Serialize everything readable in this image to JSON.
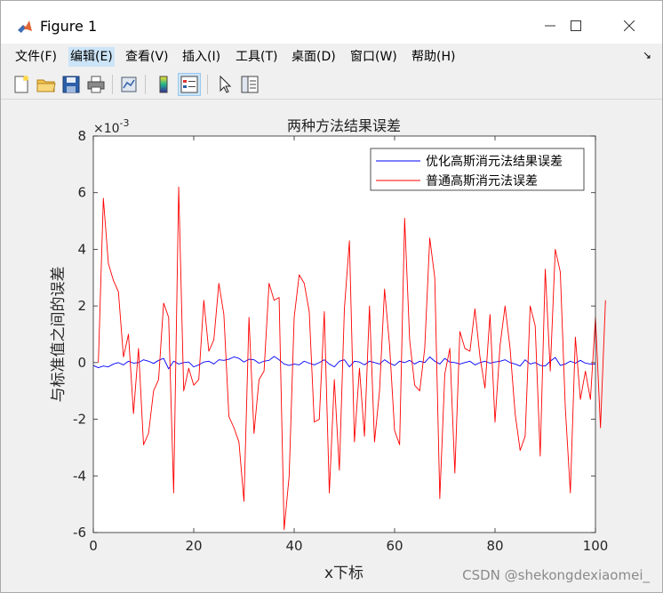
{
  "window": {
    "title": "Figure 1",
    "minimize_icon": "minimize-icon",
    "maximize_icon": "maximize-icon",
    "close_icon": "close-icon"
  },
  "menu": {
    "items": [
      {
        "label": "文件(F)"
      },
      {
        "label": "编辑(E)"
      },
      {
        "label": "查看(V)"
      },
      {
        "label": "插入(I)"
      },
      {
        "label": "工具(T)"
      },
      {
        "label": "桌面(D)"
      },
      {
        "label": "窗口(W)"
      },
      {
        "label": "帮助(H)"
      }
    ],
    "active_index": 1,
    "corner_glyph": "↘"
  },
  "toolbar": {
    "buttons": [
      {
        "icon": "new-figure-icon"
      },
      {
        "icon": "open-folder-icon"
      },
      {
        "icon": "save-icon"
      },
      {
        "icon": "print-icon"
      },
      {
        "icon": "link-plot-icon"
      },
      {
        "icon": "colorbar-icon"
      },
      {
        "icon": "legend-icon"
      },
      {
        "icon": "pointer-icon"
      },
      {
        "icon": "property-editor-icon"
      }
    ],
    "active_icon": "legend-icon"
  },
  "chart_data": {
    "type": "line",
    "title": "两种方法结果误差",
    "xlabel": "x下标",
    "ylabel": "与标准值之间的误差",
    "exponent_label": "×10",
    "exponent_power": "-3",
    "xlim": [
      0,
      100
    ],
    "ylim": [
      -6,
      8
    ],
    "xticks": [
      0,
      20,
      40,
      60,
      80,
      100
    ],
    "yticks": [
      -6,
      -4,
      -2,
      0,
      2,
      4,
      6,
      8
    ],
    "grid": false,
    "legend_position": "top-right",
    "series": [
      {
        "name": "优化高斯消元法结果误差",
        "color": "#0000ff",
        "values": [
          -0.1,
          -0.18,
          -0.12,
          -0.15,
          -0.05,
          0.0,
          -0.08,
          0.05,
          -0.02,
          0.0,
          0.1,
          0.05,
          -0.03,
          0.08,
          0.15,
          -0.22,
          0.05,
          -0.05,
          0.0,
          0.02,
          -0.15,
          -0.08,
          0.02,
          0.05,
          -0.05,
          0.1,
          0.08,
          0.12,
          0.2,
          0.15,
          0.02,
          0.12,
          0.1,
          -0.02,
          0.05,
          0.08,
          0.22,
          0.1,
          -0.05,
          -0.1,
          -0.05,
          -0.08,
          0.05,
          -0.02,
          -0.08,
          0.0,
          0.1,
          -0.05,
          -0.15,
          0.05,
          0.1,
          -0.15,
          0.05,
          0.02,
          -0.08,
          0.05,
          0.0,
          -0.05,
          0.1,
          -0.02,
          -0.1,
          0.05,
          0.0,
          0.08,
          -0.05,
          0.05,
          0.0,
          0.2,
          0.05,
          -0.05,
          0.15,
          0.02,
          0.0,
          -0.05,
          0.0,
          0.05,
          -0.08,
          0.0,
          0.05,
          -0.02,
          0.02,
          0.05,
          0.1,
          0.0,
          -0.05,
          -0.12,
          0.1,
          -0.05,
          0.0,
          -0.1,
          -0.12,
          0.05,
          0.18,
          -0.1,
          -0.05,
          0.05,
          -0.02,
          0.08,
          -0.02,
          -0.05,
          -0.05
        ]
      },
      {
        "name": "普通高斯消元法误差",
        "color": "#ff0000",
        "values": [
          0,
          5.8,
          3.5,
          2.9,
          2.5,
          0.2,
          1.0,
          -1.8,
          0.5,
          -2.9,
          -2.5,
          -1.0,
          -0.6,
          2.1,
          1.6,
          -4.6,
          6.2,
          -1.0,
          -0.2,
          -0.8,
          -0.6,
          2.2,
          0.4,
          0.8,
          2.8,
          1.7,
          -1.9,
          -2.3,
          -2.8,
          -4.9,
          1.6,
          -2.5,
          -0.6,
          -0.3,
          2.8,
          2.2,
          2.3,
          -5.9,
          -4.0,
          1.6,
          3.1,
          2.8,
          1.8,
          -2.1,
          -2.0,
          1.8,
          -4.6,
          -0.6,
          -3.8,
          1.9,
          4.3,
          -2.8,
          -0.2,
          -2.6,
          2.0,
          -2.8,
          -1.0,
          2.6,
          0.6,
          -2.4,
          -2.9,
          5.1,
          0.8,
          -0.8,
          -1.0,
          0.5,
          4.4,
          3.0,
          -4.8,
          -0.4,
          0.5,
          -3.9,
          1.1,
          0.5,
          0.4,
          1.9,
          0.2,
          -0.9,
          1.7,
          -2.1,
          0.6,
          2.0,
          0.5,
          -1.8,
          -3.1,
          -2.6,
          2.0,
          1.3,
          -3.3,
          3.3,
          -0.3,
          4.0,
          3.2,
          -1.6,
          -4.6,
          0.9,
          -1.3,
          -0.3,
          -1.3,
          1.6,
          -2.3,
          2.2
        ]
      }
    ]
  },
  "watermark": "CSDN @shekongdexiaomei_"
}
